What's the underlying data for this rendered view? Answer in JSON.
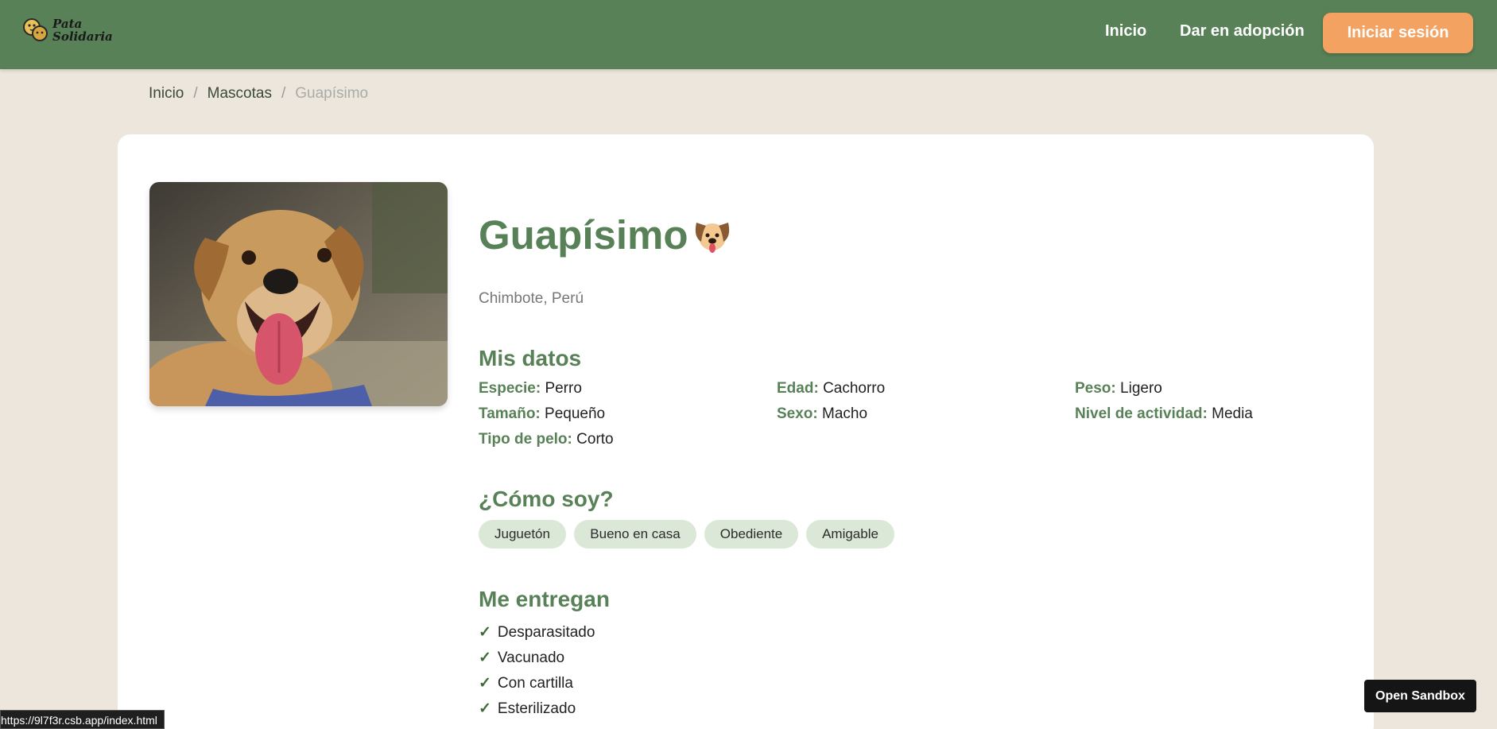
{
  "brand": {
    "line1": "Pata",
    "line2": "Solidaria",
    "logo_icon": "dog-cat-logo-icon"
  },
  "nav": {
    "links": [
      "Inicio",
      "Dar en adopción"
    ],
    "login_label": "Iniciar sesión"
  },
  "breadcrumb": {
    "items": [
      "Inicio",
      "Mascotas"
    ],
    "separator": "/",
    "current": "Guapísimo"
  },
  "pet": {
    "name": "Guapísimo",
    "emoji_icon": "dog-face-icon",
    "location": "Chimbote, Perú",
    "photo_alt": "dog-photo"
  },
  "sections": {
    "datos_title": "Mis datos",
    "como_title": "¿Cómo soy?",
    "entregan_title": "Me entregan"
  },
  "datos": [
    {
      "label": "Especie:",
      "value": "Perro"
    },
    {
      "label": "Edad:",
      "value": "Cachorro"
    },
    {
      "label": "Peso:",
      "value": "Ligero"
    },
    {
      "label": "Tamaño:",
      "value": "Pequeño"
    },
    {
      "label": "Sexo:",
      "value": "Macho"
    },
    {
      "label": "Nivel de actividad:",
      "value": "Media"
    },
    {
      "label": "Tipo de pelo:",
      "value": "Corto"
    }
  ],
  "traits": [
    "Juguetón",
    "Bueno en casa",
    "Obediente",
    "Amigable"
  ],
  "delivered": [
    "Desparasitado",
    "Vacunado",
    "Con cartilla",
    "Esterilizado"
  ],
  "check_symbol": "✓",
  "status_url": "https://9l7f3r.csb.app/index.html",
  "sandbox_label": "Open Sandbox",
  "colors": {
    "primary": "#588157",
    "accent": "#f4a261",
    "background": "#ede6dc",
    "tag": "#dbe8d8"
  }
}
